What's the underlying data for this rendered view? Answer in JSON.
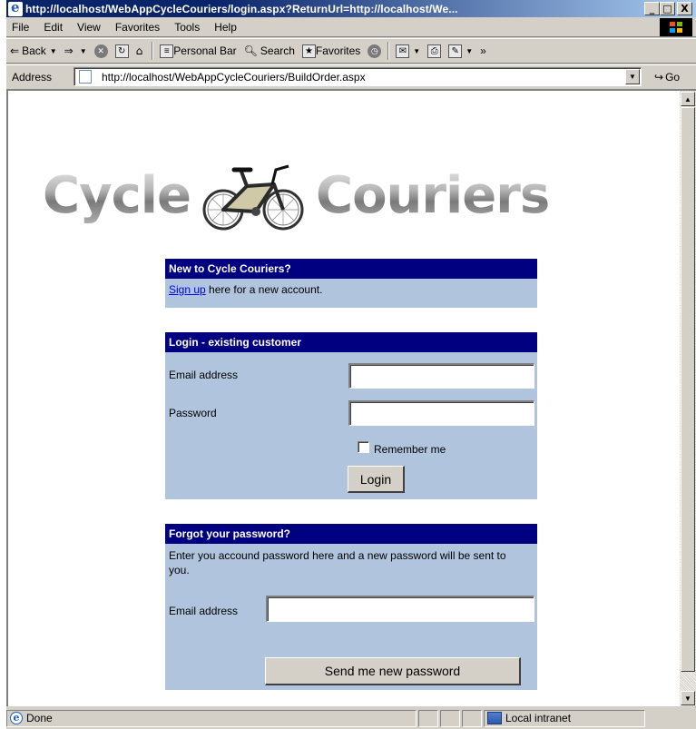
{
  "window": {
    "title": "http://localhost/WebAppCycleCouriers/login.aspx?ReturnUrl=http://localhost/We...",
    "minimize": "_",
    "maximize": "□",
    "close": "X"
  },
  "menu": [
    "File",
    "Edit",
    "View",
    "Favorites",
    "Tools",
    "Help"
  ],
  "toolbar": {
    "back": "Back",
    "personal_bar": "Personal Bar",
    "search": "Search",
    "favorites": "Favorites",
    "more": "»"
  },
  "address": {
    "label": "Address",
    "url": "http://localhost/WebAppCycleCouriers/BuildOrder.aspx",
    "go": "Go"
  },
  "logo": {
    "left_word": "Cycle",
    "right_word": "Couriers"
  },
  "signup_panel": {
    "heading": "New to Cycle Couriers?",
    "link": "Sign up",
    "text": " here for a new account."
  },
  "login_panel": {
    "heading": "Login - existing customer",
    "email_label": "Email address",
    "email_value": "",
    "password_label": "Password",
    "password_value": "",
    "remember_label": "Remember me",
    "remember_checked": false,
    "login_button": "Login"
  },
  "forgot_panel": {
    "heading": "Forgot your password?",
    "description": "Enter you accound password here and a new password will be sent to you.",
    "email_label": "Email address",
    "email_value": "",
    "send_button": "Send me new password"
  },
  "status": {
    "text": "Done",
    "zone": "Local intranet"
  },
  "colors": {
    "panel_heading": "#000080",
    "panel_body": "#b0c4de",
    "link": "#0000ee",
    "titlebar": "#0a246a"
  }
}
